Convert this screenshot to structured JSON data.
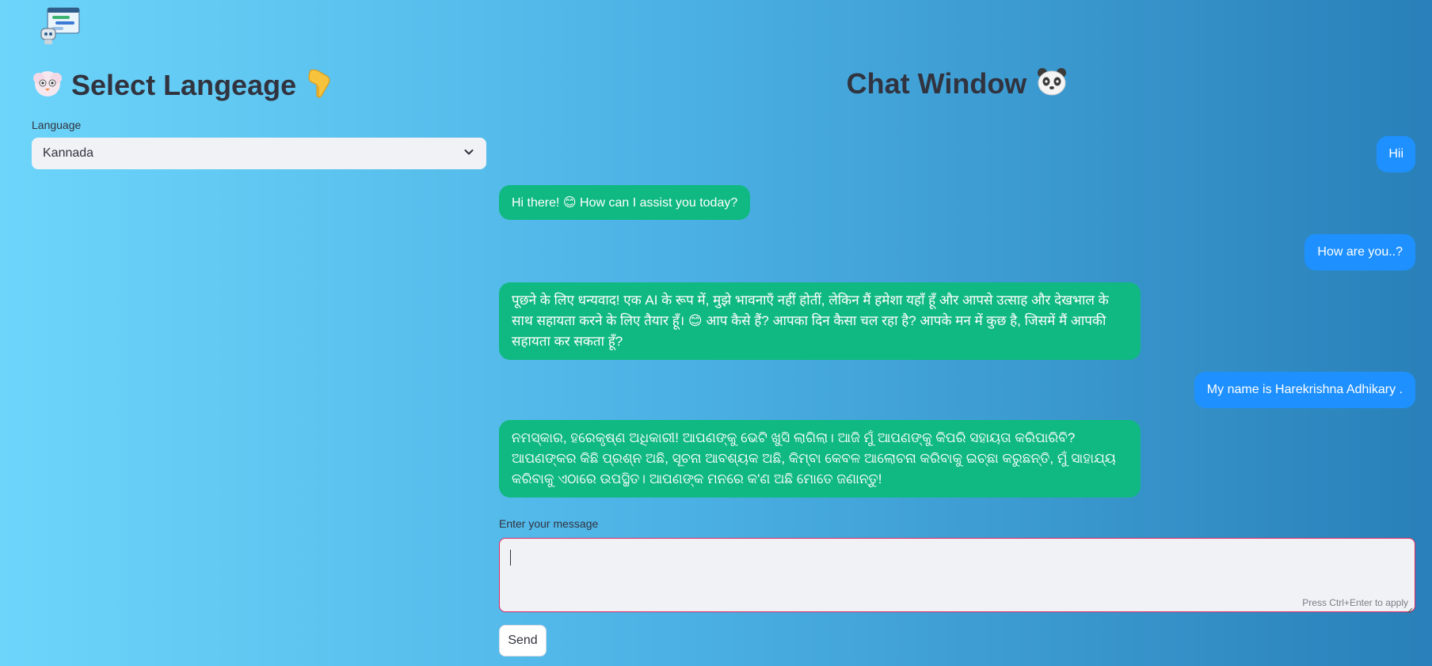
{
  "app": {
    "logo_icon": "chat-bot-icon"
  },
  "left": {
    "title": "Select Langeage",
    "title_icon_left": "cloud-face-icon",
    "title_icon_right": "pointing-down-icon",
    "language_label": "Language",
    "language_selected": "Kannada"
  },
  "chat": {
    "title": "Chat Window",
    "title_icon": "panda-icon",
    "messages": [
      {
        "role": "user",
        "text": "Hii"
      },
      {
        "role": "assistant",
        "text": "Hi there! 😊 How can I assist you today?"
      },
      {
        "role": "user",
        "text": "How are you..?"
      },
      {
        "role": "assistant",
        "text": "पूछने के लिए धन्यवाद! एक AI के रूप में, मुझे भावनाएँ नहीं होतीं, लेकिन मैं हमेशा यहाँ हूँ और आपसे उत्साह और देखभाल के साथ सहायता करने के लिए तैयार हूँ। 😊 आप कैसे हैं? आपका दिन कैसा चल रहा है? आपके मन में कुछ है, जिसमें मैं आपकी सहायता कर सकता हूँ?"
      },
      {
        "role": "user",
        "text": "My name is Harekrishna Adhikary ."
      },
      {
        "role": "assistant",
        "text": "ନମସ୍କାର, ହରେକୃଷ୍ଣ ଅଧିକାରୀ! ଆପଣଙ୍କୁ ଭେଟି ଖୁସି ଲାଗିଲା। ଆଜି ମୁଁ ଆପଣଙ୍କୁ କିପରି ସହାୟତା କରିପାରିବି? ଆପଣଙ୍କର କିଛି ପ୍ରଶ୍ନ ଅଛି, ସୂଚନା ଆବଶ୍ୟକ ଅଛି, କିମ୍ବା କେବଳ ଆଲୋଚନା କରିବାକୁ ଇଚ୍ଛା କରୁଛନ୍ତି, ମୁଁ ସାହାଯ୍ୟ କରିବାକୁ ଏଠାରେ ଉପସ୍ଥିତ। ଆପଣଙ୍କ ମନରେ କ'ଣ ଅଛି ମୋତେ ଜଣାନ୍ତୁ!"
      }
    ],
    "input_label": "Enter your message",
    "input_value": "",
    "input_hint": "Press Ctrl+Enter to apply",
    "send_label": "Send"
  },
  "colors": {
    "user_bubble": "#1e90ff",
    "assistant_bubble": "#10b981",
    "input_border": "#e0245e"
  }
}
